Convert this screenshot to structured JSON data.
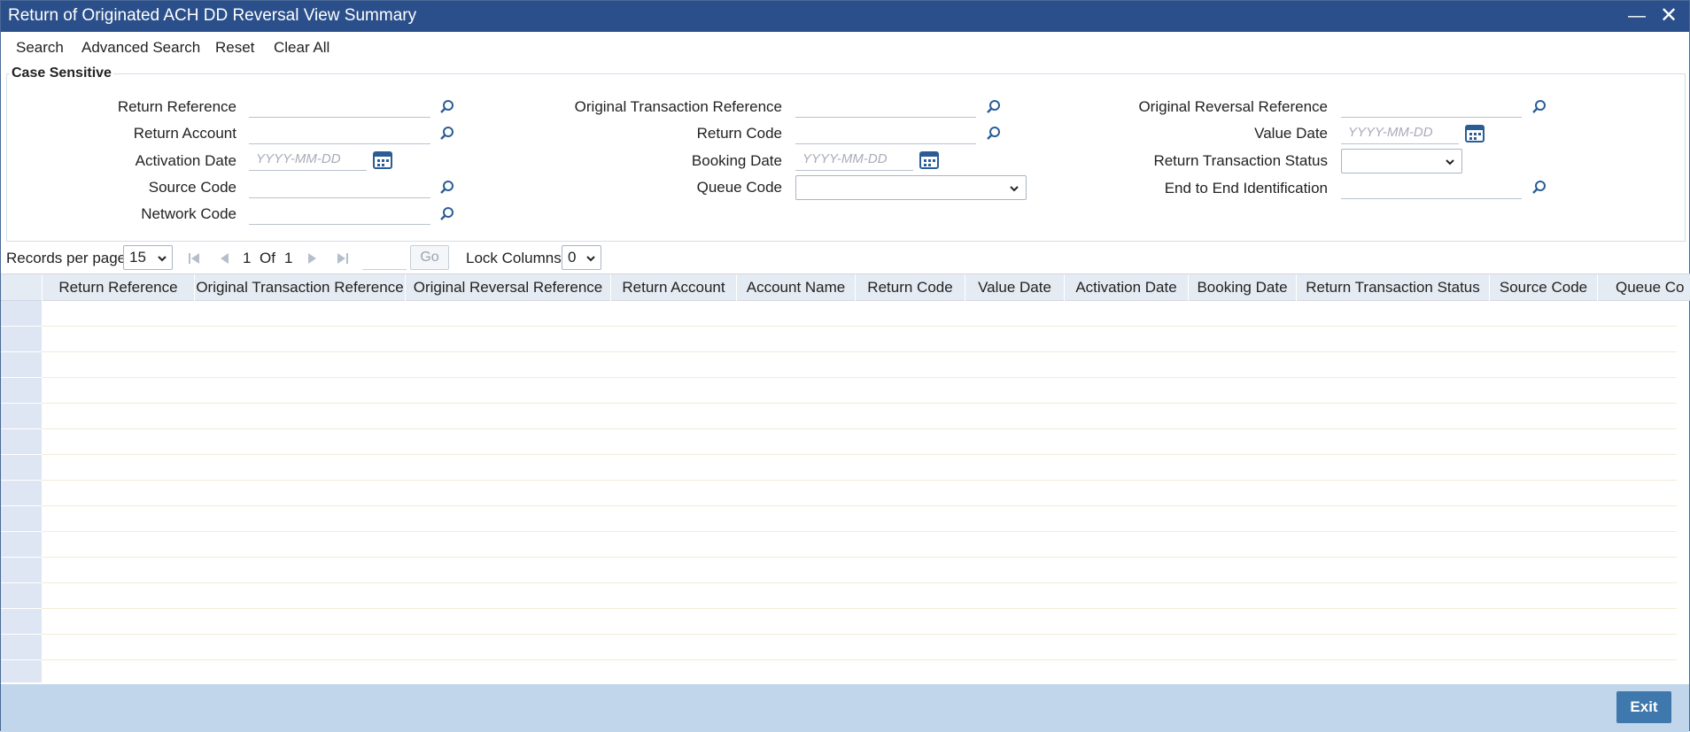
{
  "window": {
    "title": "Return of Originated ACH DD Reversal View Summary"
  },
  "toolbar": {
    "search": "Search",
    "advanced_search": "Advanced Search",
    "reset": "Reset",
    "clear_all": "Clear All"
  },
  "criteria": {
    "legend": "Case Sensitive",
    "return_reference": "Return Reference",
    "return_account": "Return Account",
    "activation_date": "Activation Date",
    "source_code": "Source Code",
    "network_code": "Network Code",
    "original_transaction_reference": "Original Transaction Reference",
    "return_code": "Return Code",
    "booking_date": "Booking Date",
    "queue_code": "Queue Code",
    "original_reversal_reference": "Original Reversal Reference",
    "value_date": "Value Date",
    "return_transaction_status": "Return Transaction Status",
    "end_to_end_identification": "End to End Identification",
    "date_placeholder": "YYYY-MM-DD"
  },
  "pager": {
    "records_per_page_label": "Records per page",
    "records_per_page": "15",
    "current_page": "1",
    "of_label": "Of",
    "total_pages": "1",
    "go_label": "Go",
    "lock_columns_label": "Lock Columns",
    "lock_columns": "0"
  },
  "grid": {
    "columns": [
      "Return Reference",
      "Original Transaction Reference",
      "Original Reversal Reference",
      "Return Account",
      "Account Name",
      "Return Code",
      "Value Date",
      "Activation Date",
      "Booking Date",
      "Return Transaction Status",
      "Source Code",
      "Queue Co"
    ],
    "rows": []
  },
  "footer": {
    "exit_label": "Exit"
  },
  "icons": {
    "lookup": "magnifier-icon",
    "calendar": "calendar-icon",
    "dropdown": "chevron-down-icon"
  },
  "colors": {
    "titlebar": "#2a4f8a",
    "footer": "#c1d6ea",
    "exit_button": "#3f78ad",
    "grid_header": "#e5ebf3"
  }
}
